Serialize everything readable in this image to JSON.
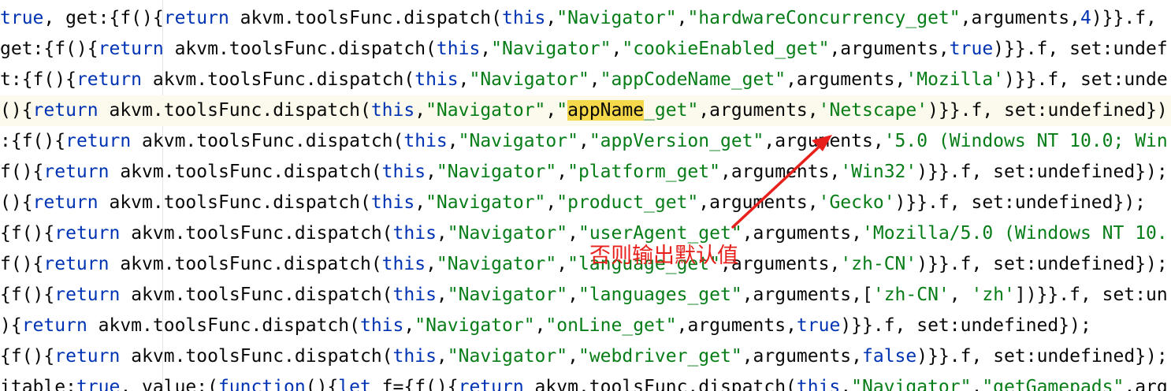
{
  "lines": [
    [
      {
        "t": "true",
        "c": "kw"
      },
      {
        "t": ", get:{f(){"
      },
      {
        "t": "return",
        "c": "kw"
      },
      {
        "t": " akvm.toolsFunc.dispatch("
      },
      {
        "t": "this",
        "c": "kw"
      },
      {
        "t": ","
      },
      {
        "t": "\"Navigator\"",
        "c": "str"
      },
      {
        "t": ","
      },
      {
        "t": "\"hardwareConcurrency_get\"",
        "c": "str"
      },
      {
        "t": ",arguments,"
      },
      {
        "t": "4",
        "c": "kw"
      },
      {
        "t": ")}}.f, "
      }
    ],
    [
      {
        "t": "get:{f(){"
      },
      {
        "t": "return",
        "c": "kw"
      },
      {
        "t": " akvm.toolsFunc.dispatch("
      },
      {
        "t": "this",
        "c": "kw"
      },
      {
        "t": ","
      },
      {
        "t": "\"Navigator\"",
        "c": "str"
      },
      {
        "t": ","
      },
      {
        "t": "\"cookieEnabled_get\"",
        "c": "str"
      },
      {
        "t": ",arguments,"
      },
      {
        "t": "true",
        "c": "kw"
      },
      {
        "t": ")}}.f, set:undef"
      }
    ],
    [
      {
        "t": "t:{f(){"
      },
      {
        "t": "return",
        "c": "kw"
      },
      {
        "t": " akvm.toolsFunc.dispatch("
      },
      {
        "t": "this",
        "c": "kw"
      },
      {
        "t": ","
      },
      {
        "t": "\"Navigator\"",
        "c": "str"
      },
      {
        "t": ","
      },
      {
        "t": "\"appCodeName_get\"",
        "c": "str"
      },
      {
        "t": ",arguments,"
      },
      {
        "t": "'Mozilla'",
        "c": "str"
      },
      {
        "t": ")}}.f, set:unde"
      }
    ],
    [
      {
        "t": "(){"
      },
      {
        "t": "return",
        "c": "kw"
      },
      {
        "t": " akvm.toolsFunc.dispatch("
      },
      {
        "t": "this",
        "c": "kw"
      },
      {
        "t": ","
      },
      {
        "t": "\"Navigator\"",
        "c": "str"
      },
      {
        "t": ","
      },
      {
        "t": "\"",
        "c": "str"
      },
      {
        "t": "appName",
        "c": "hl"
      },
      {
        "t": "_get\"",
        "c": "str"
      },
      {
        "t": ",arguments,"
      },
      {
        "t": "'Netscape'",
        "c": "str"
      },
      {
        "t": ")}}.f, set:undefined})"
      }
    ],
    [
      {
        "t": ":{f(){"
      },
      {
        "t": "return",
        "c": "kw"
      },
      {
        "t": " akvm.toolsFunc.dispatch("
      },
      {
        "t": "this",
        "c": "kw"
      },
      {
        "t": ","
      },
      {
        "t": "\"Navigator\"",
        "c": "str"
      },
      {
        "t": ","
      },
      {
        "t": "\"appVersion_get\"",
        "c": "str"
      },
      {
        "t": ",arguments,"
      },
      {
        "t": "'5.0 (Windows NT 10.0; Win",
        "c": "str"
      }
    ],
    [
      {
        "t": "f(){"
      },
      {
        "t": "return",
        "c": "kw"
      },
      {
        "t": " akvm.toolsFunc.dispatch("
      },
      {
        "t": "this",
        "c": "kw"
      },
      {
        "t": ","
      },
      {
        "t": "\"Navigator\"",
        "c": "str"
      },
      {
        "t": ","
      },
      {
        "t": "\"platform_get\"",
        "c": "str"
      },
      {
        "t": ",arguments,"
      },
      {
        "t": "'Win32'",
        "c": "str"
      },
      {
        "t": ")}}.f, set:undefined});"
      }
    ],
    [
      {
        "t": "(){"
      },
      {
        "t": "return",
        "c": "kw"
      },
      {
        "t": " akvm.toolsFunc.dispatch("
      },
      {
        "t": "this",
        "c": "kw"
      },
      {
        "t": ","
      },
      {
        "t": "\"Navigator\"",
        "c": "str"
      },
      {
        "t": ","
      },
      {
        "t": "\"product_get\"",
        "c": "str"
      },
      {
        "t": ",arguments,"
      },
      {
        "t": "'Gecko'",
        "c": "str"
      },
      {
        "t": ")}}.f, set:undefined});"
      }
    ],
    [
      {
        "t": "{f(){"
      },
      {
        "t": "return",
        "c": "kw"
      },
      {
        "t": " akvm.toolsFunc.dispatch("
      },
      {
        "t": "this",
        "c": "kw"
      },
      {
        "t": ","
      },
      {
        "t": "\"Navigator\"",
        "c": "str"
      },
      {
        "t": ","
      },
      {
        "t": "\"userAgent_get\"",
        "c": "str"
      },
      {
        "t": ",arguments,"
      },
      {
        "t": "'Mozilla/5.0 (Windows NT 10.",
        "c": "str"
      }
    ],
    [
      {
        "t": "f(){"
      },
      {
        "t": "return",
        "c": "kw"
      },
      {
        "t": " akvm.toolsFunc.dispatch("
      },
      {
        "t": "this",
        "c": "kw"
      },
      {
        "t": ","
      },
      {
        "t": "\"Navigator\"",
        "c": "str"
      },
      {
        "t": ","
      },
      {
        "t": "\"language_get\"",
        "c": "str"
      },
      {
        "t": ",arguments,"
      },
      {
        "t": "'zh-CN'",
        "c": "str"
      },
      {
        "t": ")}}.f, set:undefined});"
      }
    ],
    [
      {
        "t": "{f(){"
      },
      {
        "t": "return",
        "c": "kw"
      },
      {
        "t": " akvm.toolsFunc.dispatch("
      },
      {
        "t": "this",
        "c": "kw"
      },
      {
        "t": ","
      },
      {
        "t": "\"Navigator\"",
        "c": "str"
      },
      {
        "t": ","
      },
      {
        "t": "\"languages_get\"",
        "c": "str"
      },
      {
        "t": ",arguments,["
      },
      {
        "t": "'zh-CN'",
        "c": "str"
      },
      {
        "t": ", "
      },
      {
        "t": "'zh'",
        "c": "str"
      },
      {
        "t": "])}}.f, set:un"
      }
    ],
    [
      {
        "t": "){"
      },
      {
        "t": "return",
        "c": "kw"
      },
      {
        "t": " akvm.toolsFunc.dispatch("
      },
      {
        "t": "this",
        "c": "kw"
      },
      {
        "t": ","
      },
      {
        "t": "\"Navigator\"",
        "c": "str"
      },
      {
        "t": ","
      },
      {
        "t": "\"onLine_get\"",
        "c": "str"
      },
      {
        "t": ",arguments,"
      },
      {
        "t": "true",
        "c": "kw"
      },
      {
        "t": ")}}.f, set:undefined});"
      }
    ],
    [
      {
        "t": "{f(){"
      },
      {
        "t": "return",
        "c": "kw"
      },
      {
        "t": " akvm.toolsFunc.dispatch("
      },
      {
        "t": "this",
        "c": "kw"
      },
      {
        "t": ","
      },
      {
        "t": "\"Navigator\"",
        "c": "str"
      },
      {
        "t": ","
      },
      {
        "t": "\"webdriver_get\"",
        "c": "str"
      },
      {
        "t": ",arguments,"
      },
      {
        "t": "false",
        "c": "kw"
      },
      {
        "t": ")}}.f, set:undefined});"
      }
    ],
    [
      {
        "t": "itable:"
      },
      {
        "t": "true",
        "c": "kw"
      },
      {
        "t": ", value:("
      },
      {
        "t": "function",
        "c": "kw"
      },
      {
        "t": "(){"
      },
      {
        "t": "let",
        "c": "kw"
      },
      {
        "t": " f={f(){"
      },
      {
        "t": "return",
        "c": "kw"
      },
      {
        "t": " akvm.toolsFunc.dispatch("
      },
      {
        "t": "this",
        "c": "kw"
      },
      {
        "t": ","
      },
      {
        "t": "\"Navigator\"",
        "c": "str"
      },
      {
        "t": ","
      },
      {
        "t": "\"getGamepads\"",
        "c": "str"
      },
      {
        "t": ",arg"
      }
    ]
  ],
  "current_line_index": 3,
  "annotation": {
    "text": "否则输出默认值",
    "color": "#e8201c"
  },
  "colors": {
    "keyword": "#0033b3",
    "string": "#067d17",
    "plain": "#080808",
    "highlight": "#f5d94a",
    "current_line": "#fcfaed"
  }
}
